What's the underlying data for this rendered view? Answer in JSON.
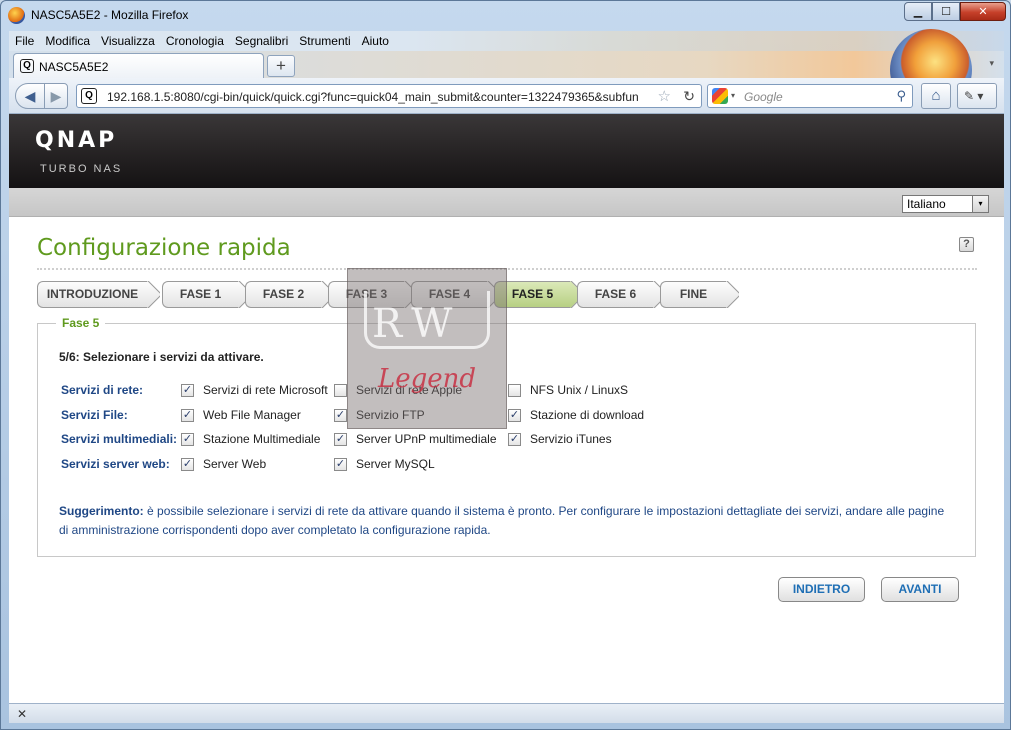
{
  "window": {
    "title": "NASC5A5E2 - Mozilla Firefox",
    "controls": {
      "minimize": "▁",
      "maximize": "☐",
      "close": "✕"
    }
  },
  "menu": [
    "File",
    "Modifica",
    "Visualizza",
    "Cronologia",
    "Segnalibri",
    "Strumenti",
    "Aiuto"
  ],
  "tab": {
    "label": "NASC5A5E2",
    "new_tab": "+",
    "list_arrow": "▾"
  },
  "nav": {
    "back": "◀",
    "forward": "▶",
    "url": "192.168.1.5:8080/cgi-bin/quick/quick.cgi?func=quick04_main_submit&counter=1322479365&subfun",
    "star": "☆",
    "reload": "↻",
    "search_placeholder": "Google",
    "search_engine_arrow": "▾",
    "search_icon": "⚲",
    "home": "⌂",
    "addon": "✎ ▾"
  },
  "brand": {
    "logo": "QNAP",
    "subtitle": "TURBO NAS"
  },
  "language": {
    "selected": "Italiano",
    "arrow": "▾"
  },
  "page": {
    "title": "Configurazione rapida",
    "help": "?"
  },
  "steps": [
    {
      "label": "INTRODUZIONE",
      "active": false
    },
    {
      "label": "FASE 1",
      "active": false
    },
    {
      "label": "FASE 2",
      "active": false
    },
    {
      "label": "FASE 3",
      "active": false
    },
    {
      "label": "FASE 4",
      "active": false
    },
    {
      "label": "FASE 5",
      "active": true
    },
    {
      "label": "FASE 6",
      "active": false
    },
    {
      "label": "FINE",
      "active": false
    }
  ],
  "panel": {
    "legend": "Fase 5",
    "heading": "5/6: Selezionare i servizi da attivare.",
    "rows": [
      {
        "label": "Servizi di rete:",
        "services": [
          {
            "name": "Servizi di rete Microsoft",
            "checked": true
          },
          {
            "name": "Servizi di rete Apple",
            "checked": false
          },
          {
            "name": "NFS Unix / LinuxS",
            "checked": false
          }
        ]
      },
      {
        "label": "Servizi File:",
        "services": [
          {
            "name": "Web File Manager",
            "checked": true
          },
          {
            "name": "Servizio FTP",
            "checked": true
          },
          {
            "name": "Stazione di download",
            "checked": true
          }
        ]
      },
      {
        "label": "Servizi multimediali:",
        "services": [
          {
            "name": "Stazione Multimediale",
            "checked": true
          },
          {
            "name": "Server UPnP multimediale",
            "checked": true
          },
          {
            "name": "Servizio iTunes",
            "checked": true
          }
        ]
      },
      {
        "label": "Servizi server web:",
        "services": [
          {
            "name": "Server Web",
            "checked": true
          },
          {
            "name": "Server MySQL",
            "checked": true
          }
        ]
      }
    ],
    "hint_label": "Suggerimento:",
    "hint_text": " è possibile selezionare i servizi di rete da attivare quando il sistema è pronto. Per configurare le impostazioni dettagliate dei servizi, andare alle pagine di amministrazione corrispondenti dopo aver completato la configurazione rapida."
  },
  "buttons": {
    "back": "INDIETRO",
    "next": "AVANTI"
  },
  "watermark": {
    "letters": "RW",
    "script": "Legend"
  },
  "status": {
    "close": "✕"
  },
  "check_mark": "✓"
}
